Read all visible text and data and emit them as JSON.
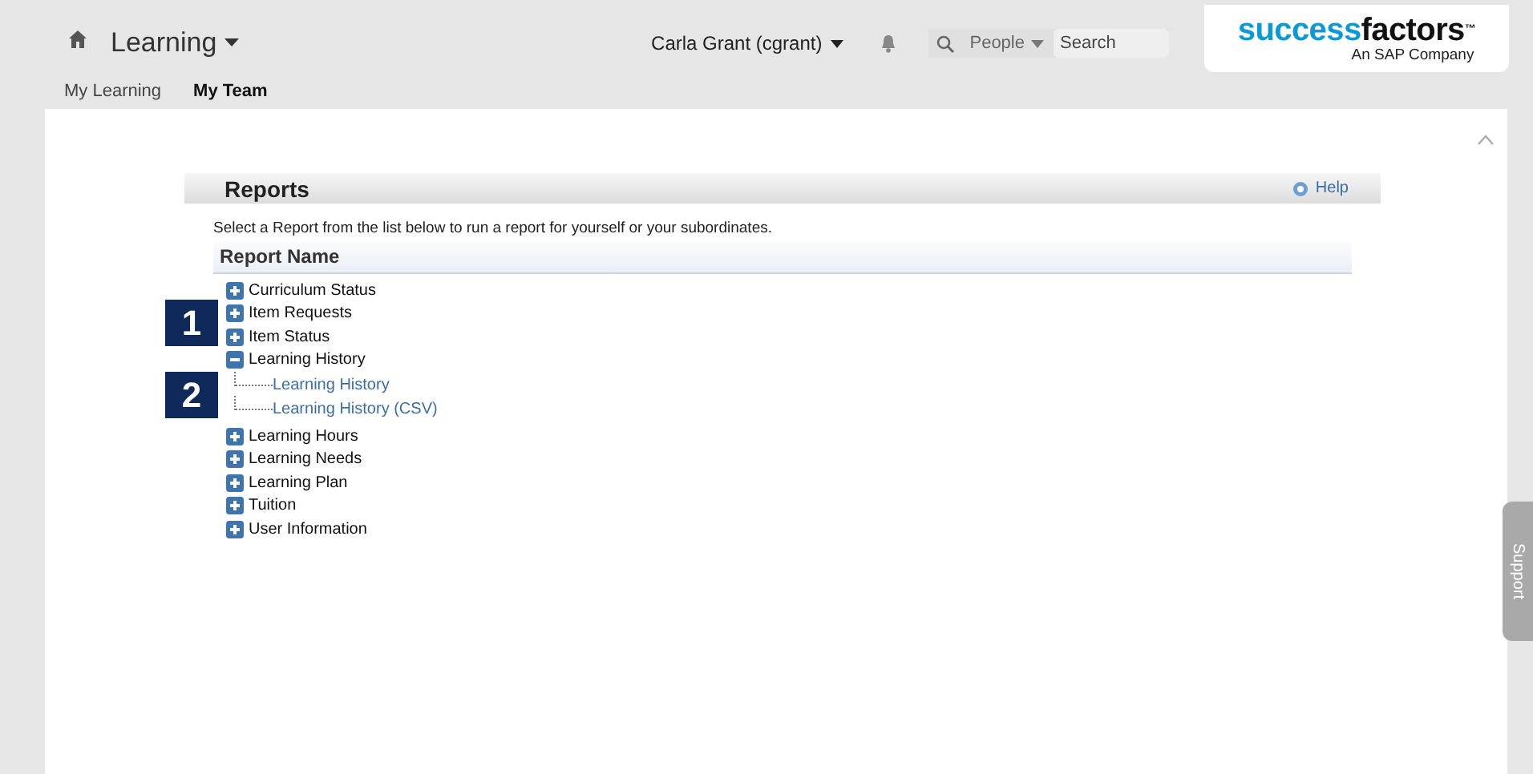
{
  "header": {
    "module": "Learning",
    "user": "Carla Grant (cgrant)",
    "search_scope": "People",
    "search": {
      "placeholder": "Search"
    },
    "logo": {
      "part_a": "success",
      "part_b": "factors",
      "tm": "™",
      "tagline": "An SAP Company"
    }
  },
  "tabs": [
    {
      "label": "My Learning",
      "selected": false
    },
    {
      "label": "My Team",
      "selected": true
    }
  ],
  "reports": {
    "title": "Reports",
    "help": "Help",
    "description": "Select a Report from the list below to run a report for yourself or your subordinates.",
    "column": "Report Name",
    "items": [
      {
        "label": "Curriculum Status",
        "expanded": false
      },
      {
        "label": "Item Requests",
        "expanded": false
      },
      {
        "label": "Item Status",
        "expanded": false
      },
      {
        "label": "Learning History",
        "expanded": true,
        "children": [
          {
            "label": "Learning History"
          },
          {
            "label": "Learning History (CSV)"
          }
        ]
      },
      {
        "label": "Learning Hours",
        "expanded": false
      },
      {
        "label": "Learning Needs",
        "expanded": false
      },
      {
        "label": "Learning Plan",
        "expanded": false
      },
      {
        "label": "Tuition",
        "expanded": false
      },
      {
        "label": "User Information",
        "expanded": false
      }
    ]
  },
  "callouts": [
    {
      "label": "1"
    },
    {
      "label": "2"
    }
  ],
  "support_tab": "Support"
}
